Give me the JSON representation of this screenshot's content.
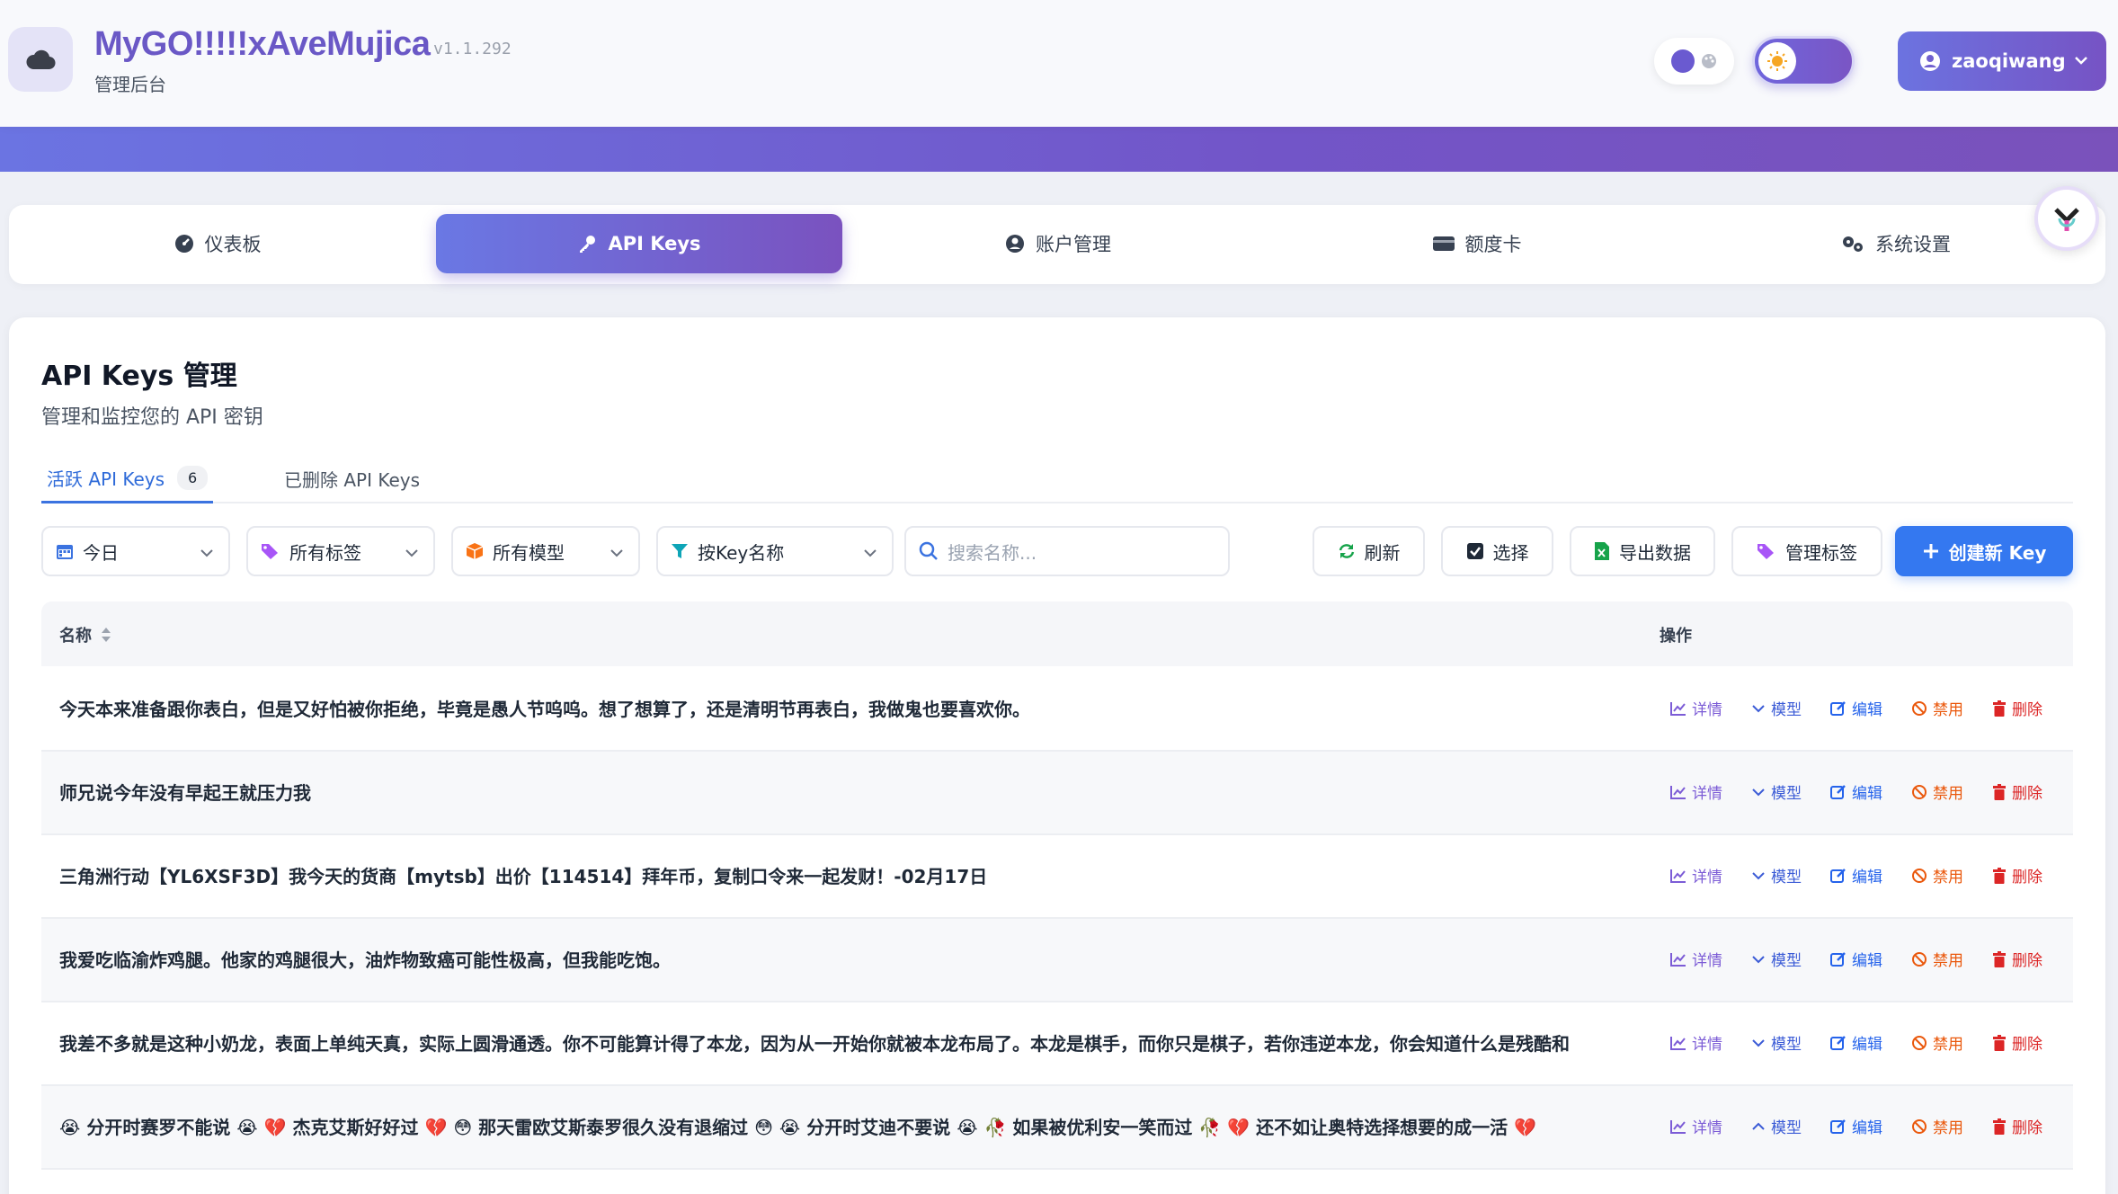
{
  "header": {
    "title": "MyGO!!!!!xAveMujica",
    "version": "v1.1.292",
    "subtitle": "管理后台",
    "user": "zaoqiwang"
  },
  "nav": {
    "items": [
      {
        "label": "仪表板",
        "icon": "dashboard-icon"
      },
      {
        "label": "API Keys",
        "icon": "key-icon"
      },
      {
        "label": "账户管理",
        "icon": "user-circle-icon"
      },
      {
        "label": "额度卡",
        "icon": "card-icon"
      },
      {
        "label": "系统设置",
        "icon": "gears-icon"
      }
    ],
    "active": 1
  },
  "page": {
    "title": "API Keys 管理",
    "subtitle": "管理和监控您的 API 密钥"
  },
  "tabs": {
    "active_label": "活跃 API Keys",
    "active_count": "6",
    "deleted_label": "已删除 API Keys"
  },
  "filters": {
    "date": "今日",
    "tags": "所有标签",
    "models": "所有模型",
    "key_filter": "按Key名称",
    "search_placeholder": "搜索名称..."
  },
  "actions": {
    "refresh": "刷新",
    "select": "选择",
    "export": "导出数据",
    "manage_tags": "管理标签",
    "create": "创建新 Key"
  },
  "table": {
    "col_name": "名称",
    "col_ops": "操作",
    "op_labels": {
      "detail": "详情",
      "model": "模型",
      "edit": "编辑",
      "disable": "禁用",
      "delete": "删除"
    },
    "rows": [
      {
        "name": "今天本来准备跟你表白，但是又好怕被你拒绝，毕竟是愚人节呜呜。想了想算了，还是清明节再表白，我做鬼也要喜欢你。"
      },
      {
        "name": "师兄说今年没有早起王就压力我"
      },
      {
        "name": "三角洲行动【YL6XSF3D】我今天的货商【mytsb】出价【114514】拜年币，复制口令来一起发财！-02月17日"
      },
      {
        "name": "我爱吃临渝炸鸡腿。他家的鸡腿很大，油炸物致癌可能性极高，但我能吃饱。"
      },
      {
        "name": "我差不多就是这种小奶龙，表面上单纯天真，实际上圆滑通透。你不可能算计得了本龙，因为从一开始你就被本龙布局了。本龙是棋手，而你只是棋子，若你违逆本龙，你会知道什么是残酷和"
      },
      {
        "name": "😭 分开时赛罗不能说 😭  💔 杰克艾斯好好过 💔  😳 那天雷欧艾斯泰罗很久没有退缩过 😳  😭 分开时艾迪不要说 😭  🥀 如果被优利安一笑而过 🥀  💔 还不如让奥特选择想要的成一活 💔"
      }
    ]
  },
  "colors": {
    "accent_start": "#6a78e4",
    "accent_end": "#7a52bf",
    "primary_button": "#3478f0",
    "title_purple": "#6a58c6"
  }
}
